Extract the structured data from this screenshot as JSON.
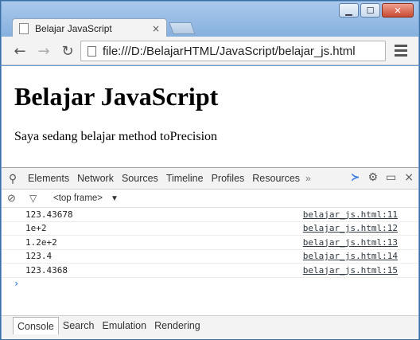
{
  "window": {
    "minimize_glyph": "▁",
    "maximize_glyph": "☐",
    "close_glyph": "✕"
  },
  "tab": {
    "title": "Belajar JavaScript",
    "close_glyph": "×"
  },
  "toolbar": {
    "back_glyph": "←",
    "forward_glyph": "→",
    "reload_glyph": "↻",
    "url": "file:///D:/BelajarHTML/JavaScript/belajar_js.html"
  },
  "page": {
    "heading": "Belajar JavaScript",
    "paragraph": "Saya sedang belajar method toPrecision"
  },
  "devtools": {
    "tabs": [
      "Elements",
      "Network",
      "Sources",
      "Timeline",
      "Profiles",
      "Resources"
    ],
    "more_glyph": "»",
    "filter": {
      "frame": "<top frame>",
      "arrow": "▼"
    },
    "logs": [
      {
        "message": "123.43678",
        "source": "belajar_js.html:11"
      },
      {
        "message": "1e+2",
        "source": "belajar_js.html:12"
      },
      {
        "message": "1.2e+2",
        "source": "belajar_js.html:13"
      },
      {
        "message": "123.4",
        "source": "belajar_js.html:14"
      },
      {
        "message": "123.4368",
        "source": "belajar_js.html:15"
      }
    ],
    "prompt_glyph": "›",
    "drawer_tabs": [
      "Console",
      "Search",
      "Emulation",
      "Rendering"
    ],
    "active_drawer_tab": "Console",
    "accent_color": "#3b7ae0"
  }
}
